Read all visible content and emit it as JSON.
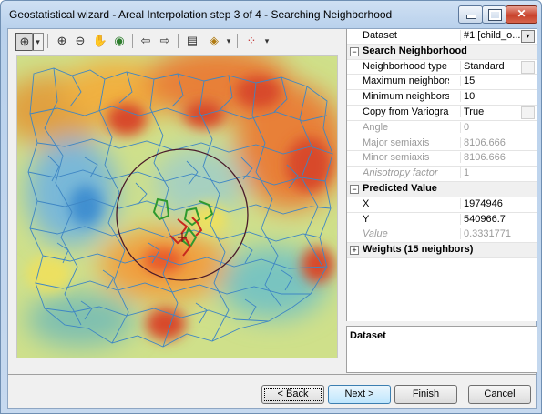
{
  "window": {
    "title": "Geostatistical wizard - Areal Interpolation step 3 of 4 - Searching Neighborhood",
    "minimize_glyph": "—",
    "maximize_glyph": "▢",
    "close_glyph": "✕"
  },
  "toolbar": {
    "icons": [
      "select-arrow-icon",
      "zoom-in-icon",
      "zoom-out-icon",
      "pan-hand-icon",
      "globe-full-extent-icon",
      "back-arrow-icon",
      "forward-arrow-icon",
      "layers-icon",
      "identify-icon",
      "symbology-icon"
    ],
    "glyphs": {
      "select": "⊕",
      "dropdown": "▾",
      "zoom_in": "⊕",
      "zoom_out": "⊖",
      "pan": "✋",
      "globe": "◉",
      "back": "⇦",
      "forward": "⇨",
      "layers": "▤",
      "identify": "◈",
      "symbology": "⁘"
    }
  },
  "properties": {
    "dataset_row": {
      "label": "Dataset",
      "value": "#1 [child_o..."
    },
    "search_neighborhood": {
      "title": "Search Neighborhood",
      "toggle": "−",
      "rows": [
        {
          "label": "Neighborhood type",
          "value": "Standard",
          "disabled": false
        },
        {
          "label": "Maximum neighbors",
          "value": "15",
          "disabled": false
        },
        {
          "label": "Minimum neighbors",
          "value": "10",
          "disabled": false
        },
        {
          "label": "Copy from Variogram",
          "value": "True",
          "disabled": false
        },
        {
          "label": "Angle",
          "value": "0",
          "disabled": true
        },
        {
          "label": "Major semiaxis",
          "value": "8106.666",
          "disabled": true
        },
        {
          "label": "Minor semiaxis",
          "value": "8106.666",
          "disabled": true
        },
        {
          "label": "Anisotropy factor",
          "value": "1",
          "disabled": true
        }
      ]
    },
    "predicted_value": {
      "title": "Predicted Value",
      "toggle": "−",
      "rows": [
        {
          "label": "X",
          "value": "1974946",
          "disabled": false
        },
        {
          "label": "Y",
          "value": "540966.7",
          "disabled": false
        },
        {
          "label": "Value",
          "value": "0.3331771",
          "disabled": true
        }
      ]
    },
    "weights": {
      "title": "Weights (15 neighbors)",
      "toggle": "+"
    }
  },
  "description_panel": {
    "title": "Dataset"
  },
  "buttons": {
    "back": "< Back",
    "next": "Next >",
    "finish": "Finish",
    "cancel": "Cancel"
  },
  "colors": {
    "map_low": "#4f9fd6",
    "map_mid": "#e6e65a",
    "map_high": "#d8492a",
    "polygon_outline": "#3e86c4",
    "search_circle": "#4a1a2a",
    "neighbor_green": "#2e9a2e",
    "neighbor_red": "#c8281e"
  }
}
